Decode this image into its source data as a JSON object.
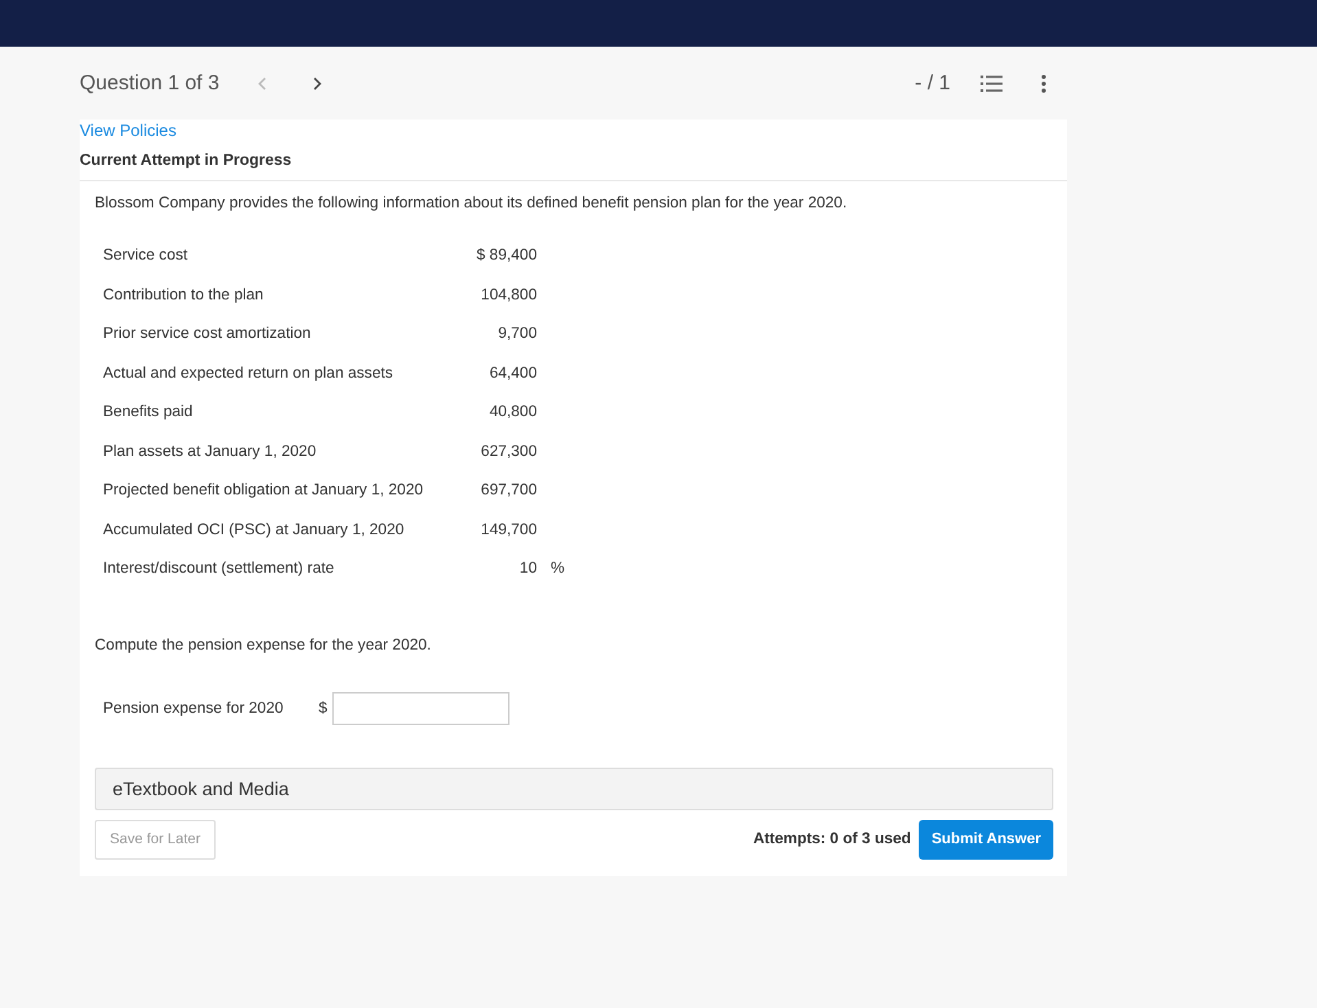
{
  "header": {
    "question_label": "Question 1 of 3",
    "prev": {
      "disabled": true
    },
    "next": {
      "disabled": false
    },
    "score": "- / 1"
  },
  "policies_link": "View Policies",
  "attempt_status": "Current Attempt in Progress",
  "question": {
    "intro": "Blossom Company provides the following information about its defined benefit pension plan for the year 2020.",
    "data_rows": [
      {
        "label": "Service cost",
        "value": "$ 89,400"
      },
      {
        "label": "Contribution to the plan",
        "value": "104,800"
      },
      {
        "label": "Prior service cost amortization",
        "value": "9,700"
      },
      {
        "label": "Actual and expected return on plan assets",
        "value": "64,400"
      },
      {
        "label": "Benefits paid",
        "value": "40,800"
      },
      {
        "label": "Plan assets at January 1, 2020",
        "value": "627,300"
      },
      {
        "label": "Projected benefit obligation at January 1, 2020",
        "value": "697,700"
      },
      {
        "label": "Accumulated OCI (PSC) at January 1, 2020",
        "value": "149,700"
      },
      {
        "label": "Interest/discount (settlement) rate",
        "value": "10",
        "unit": "%"
      }
    ],
    "prompt": "Compute the pension expense for the year 2020.",
    "answer": {
      "label": "Pension expense for 2020",
      "prefix": "$"
    }
  },
  "etextbook": {
    "label": "eTextbook and Media"
  },
  "footer": {
    "save_button": {
      "label": "Save for Later",
      "disabled": true
    },
    "attempts": "Attempts: 0 of 3 used",
    "submit_button": {
      "label": "Submit Answer",
      "disabled": false
    }
  }
}
